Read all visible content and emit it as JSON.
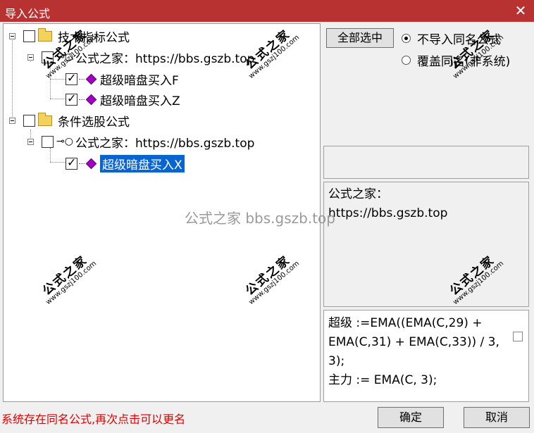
{
  "window": {
    "title": "导入公式",
    "close_icon": "close-icon"
  },
  "tree": {
    "groups": [
      {
        "label": "技术指标公式",
        "source": "公式之家：https://bbs.gszb.top",
        "items": [
          "超级暗盘买入F",
          "超级暗盘买入Z"
        ]
      },
      {
        "label": "条件选股公式",
        "source": "公式之家：https://bbs.gszb.top",
        "items": [
          "超级暗盘买入X"
        ]
      }
    ]
  },
  "right": {
    "select_all_label": "全部选中",
    "radio_no_import": "不导入同名公式",
    "radio_overwrite": "覆盖同名(非系统)",
    "description": "公式之家：\nhttps://bbs.gszb.top",
    "code": "超级 :=EMA((EMA(C,29) +\nEMA(C,31) + EMA(C,33)) / 3,\n3);\n主力 := EMA(C, 3);"
  },
  "footer": {
    "status": "系统存在同名公式,再次点击可以更名",
    "ok_label": "确定",
    "cancel_label": "取消"
  },
  "watermark": {
    "text": "公式之家 bbs.gszb.top",
    "stamp_title": "公式之家",
    "stamp_url": "www.gszj100.com"
  }
}
